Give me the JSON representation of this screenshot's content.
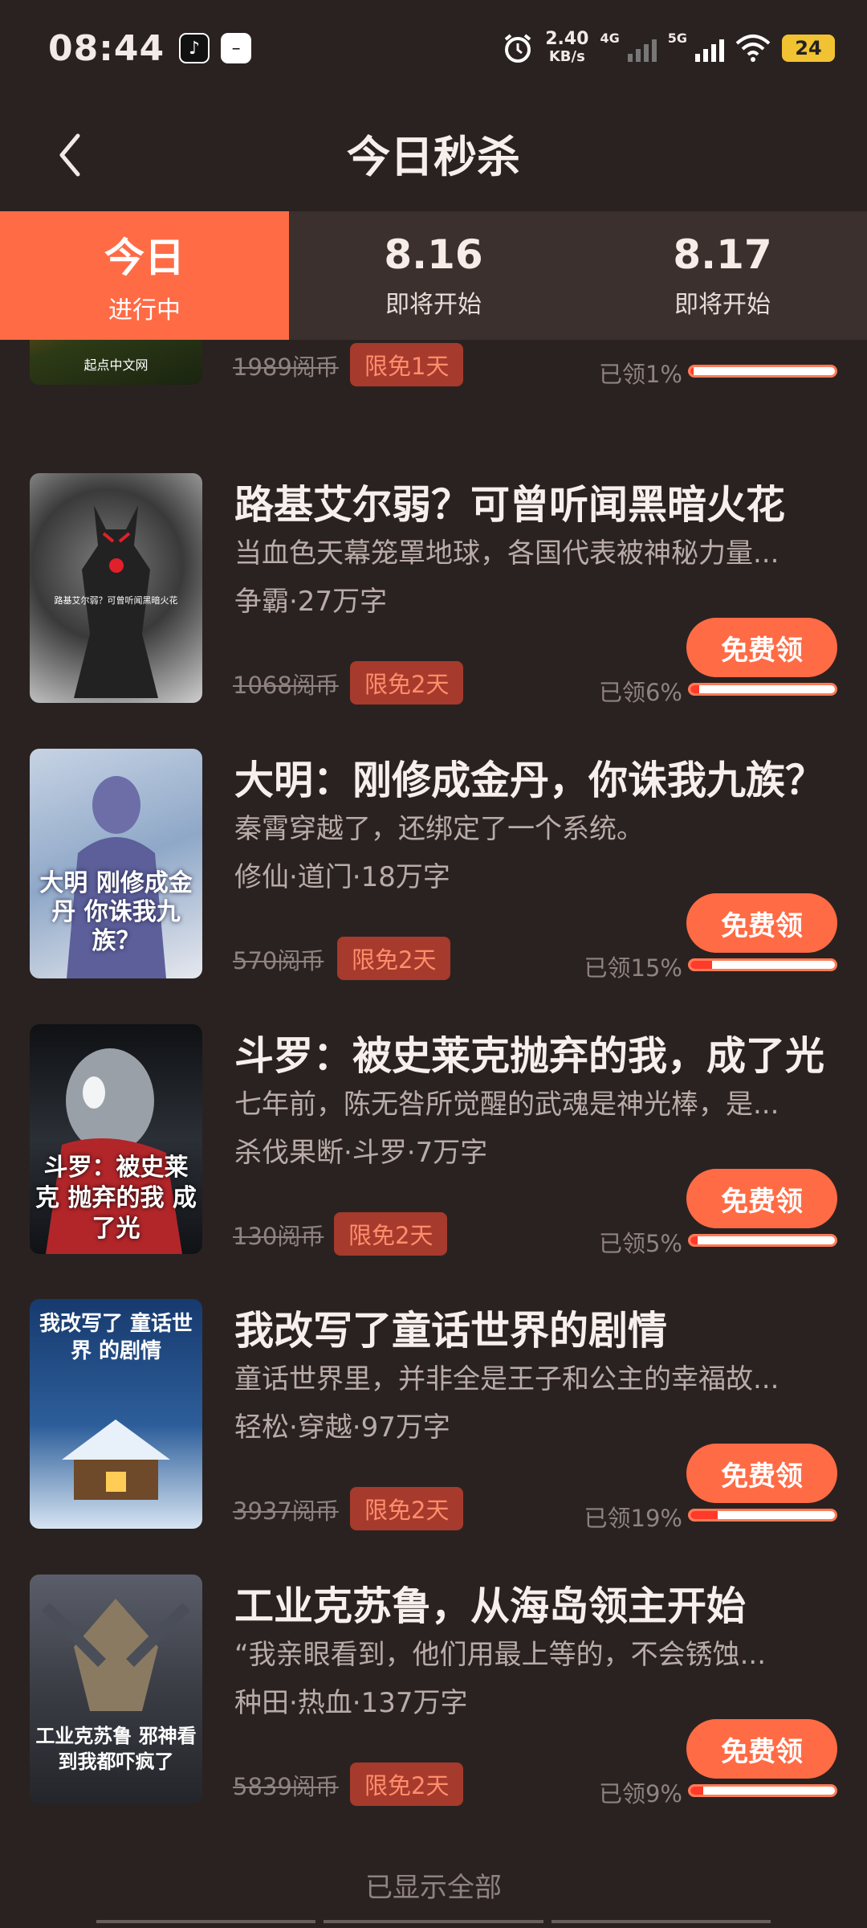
{
  "status_bar": {
    "time": "08:44",
    "net_speed_value": "2.40",
    "net_speed_unit": "KB/s",
    "network_1": "4G",
    "network_2": "5G",
    "battery": "24"
  },
  "header": {
    "title": "今日秒杀"
  },
  "tabs": [
    {
      "main": "今日",
      "sub": "进行中"
    },
    {
      "main": "8.16",
      "sub": "即将开始"
    },
    {
      "main": "8.17",
      "sub": "即将开始"
    }
  ],
  "claim_button_label": "免费领",
  "books": [
    {
      "title": "",
      "desc": "",
      "tags": "",
      "price": "1989阅币",
      "limit": "限免1天",
      "claimed": "已领1%",
      "progress_pct": 1,
      "cover_text": "起点中文网"
    },
    {
      "title": "路基艾尔弱？可曾听闻黑暗火花",
      "desc": "当血色天幕笼罩地球，各国代表被神秘力量...",
      "tags": "争霸·27万字",
      "price": "1068阅币",
      "limit": "限免2天",
      "claimed": "已领6%",
      "progress_pct": 6,
      "cover_text": "路基艾尔弱？可曾听闻黑暗火花"
    },
    {
      "title": "大明：刚修成金丹，你诛我九族？",
      "desc": "秦霄穿越了，还绑定了一个系统。",
      "tags": "修仙·道门·18万字",
      "price": "570阅币",
      "limit": "限免2天",
      "claimed": "已领15%",
      "progress_pct": 15,
      "cover_text": "大明 刚修成金丹 你诛我九族？"
    },
    {
      "title": "斗罗：被史莱克抛弃的我，成了光",
      "desc": "七年前，陈无咎所觉醒的武魂是神光棒，是...",
      "tags": "杀伐果断·斗罗·7万字",
      "price": "130阅币",
      "limit": "限免2天",
      "claimed": "已领5%",
      "progress_pct": 5,
      "cover_text": "斗罗：被史莱克 抛弃的我 成了光"
    },
    {
      "title": "我改写了童话世界的剧情",
      "desc": "童话世界里，并非全是王子和公主的幸福故...",
      "tags": "轻松·穿越·97万字",
      "price": "3937阅币",
      "limit": "限免2天",
      "claimed": "已领19%",
      "progress_pct": 19,
      "cover_text": "我改写了 童话世界 的剧情"
    },
    {
      "title": "工业克苏鲁，从海岛领主开始",
      "desc": "“我亲眼看到，他们用最上等的，不会锈蚀...",
      "tags": "种田·热血·137万字",
      "price": "5839阅币",
      "limit": "限免2天",
      "claimed": "已领9%",
      "progress_pct": 9,
      "cover_text": "工业克苏鲁 邪神看到我都吓疯了"
    }
  ],
  "footer": {
    "text": "已显示全部"
  },
  "colors": {
    "accent": "#ff6b45",
    "background": "#2a2220",
    "badge": "#a63a2c"
  }
}
